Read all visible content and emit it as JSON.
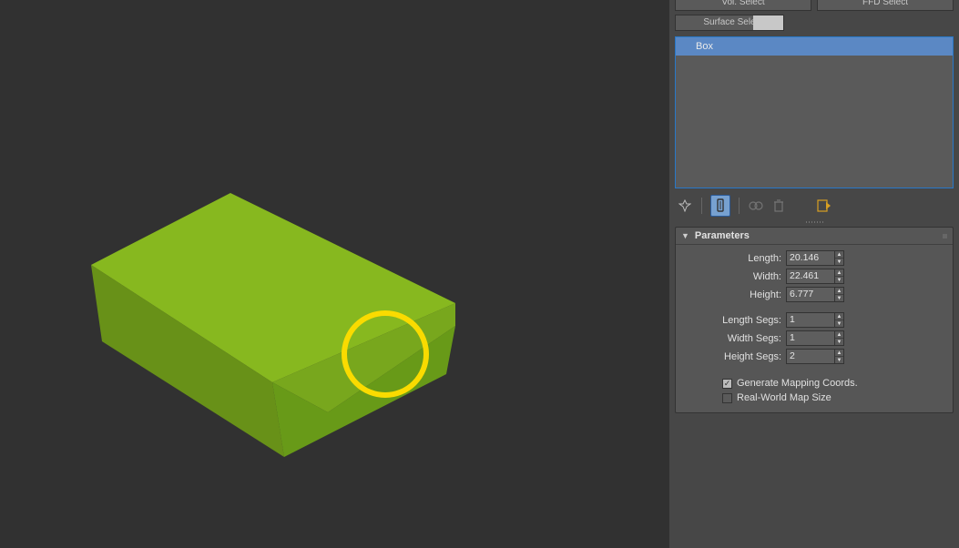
{
  "modifier_buttons": {
    "vol_select": "Vol. Select",
    "ffd_select": "FFD Select",
    "surface_select": "Surface Sele"
  },
  "modifier_stack": {
    "items": [
      {
        "label": "Box"
      }
    ]
  },
  "rollout": {
    "title": "Parameters"
  },
  "params": {
    "length": {
      "label": "Length:",
      "value": "20.146"
    },
    "width": {
      "label": "Width:",
      "value": "22.461"
    },
    "height": {
      "label": "Height:",
      "value": "6.777"
    },
    "length_segs": {
      "label": "Length Segs:",
      "value": "1"
    },
    "width_segs": {
      "label": "Width Segs:",
      "value": "1"
    },
    "height_segs": {
      "label": "Height Segs:",
      "value": "2"
    },
    "gen_mapping": {
      "label": "Generate Mapping Coords.",
      "checked": true
    },
    "real_world": {
      "label": "Real-World Map Size",
      "checked": false
    }
  }
}
